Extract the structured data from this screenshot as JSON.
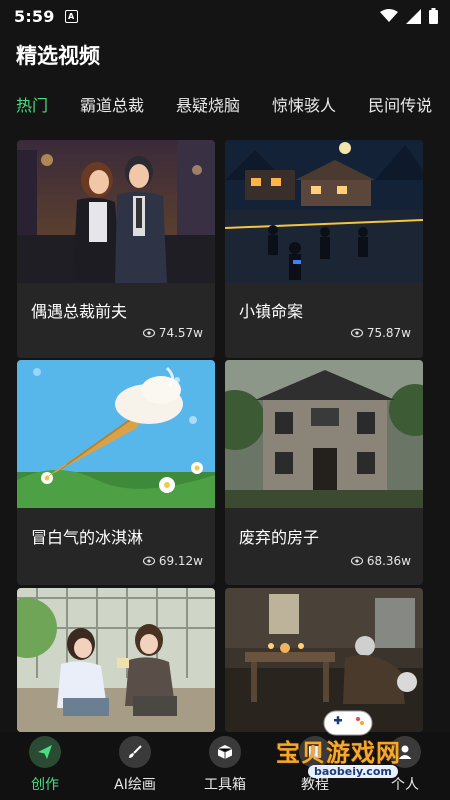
{
  "status_bar": {
    "time": "5:59",
    "notification_badge": "A"
  },
  "header": {
    "title": "精选视频"
  },
  "tabs": [
    {
      "label": "热门",
      "active": true
    },
    {
      "label": "霸道总裁",
      "active": false
    },
    {
      "label": "悬疑烧脑",
      "active": false
    },
    {
      "label": "惊悚骇人",
      "active": false
    },
    {
      "label": "民间传说",
      "active": false
    }
  ],
  "videos": [
    {
      "title": "偶遇总裁前夫",
      "views": "74.57w",
      "thumb_desc": "couple-in-suits-night-city"
    },
    {
      "title": "小镇命案",
      "views": "75.87w",
      "thumb_desc": "police-at-night-town"
    },
    {
      "title": "冒白气的冰淇淋",
      "views": "69.12w",
      "thumb_desc": "ice-cream-cone-flowers"
    },
    {
      "title": "废弃的房子",
      "views": "68.36w",
      "thumb_desc": "abandoned-house"
    },
    {
      "title": "",
      "views": "",
      "thumb_desc": "two-girls-eating"
    },
    {
      "title": "",
      "views": "",
      "thumb_desc": "old-room-kneeling"
    }
  ],
  "bottom_nav": [
    {
      "label": "创作",
      "icon": "send-icon",
      "active": true
    },
    {
      "label": "AI绘画",
      "icon": "brush-icon",
      "active": false
    },
    {
      "label": "工具箱",
      "icon": "box-icon",
      "active": false
    },
    {
      "label": "教程",
      "icon": "book-icon",
      "active": false
    },
    {
      "label": "个人",
      "icon": "person-icon",
      "active": false
    }
  ],
  "watermark": {
    "text_cn": "宝贝游戏网",
    "text_en": "baobeiy.com"
  },
  "colors": {
    "accent": "#4ade80",
    "background": "#141414",
    "card": "#262626"
  }
}
